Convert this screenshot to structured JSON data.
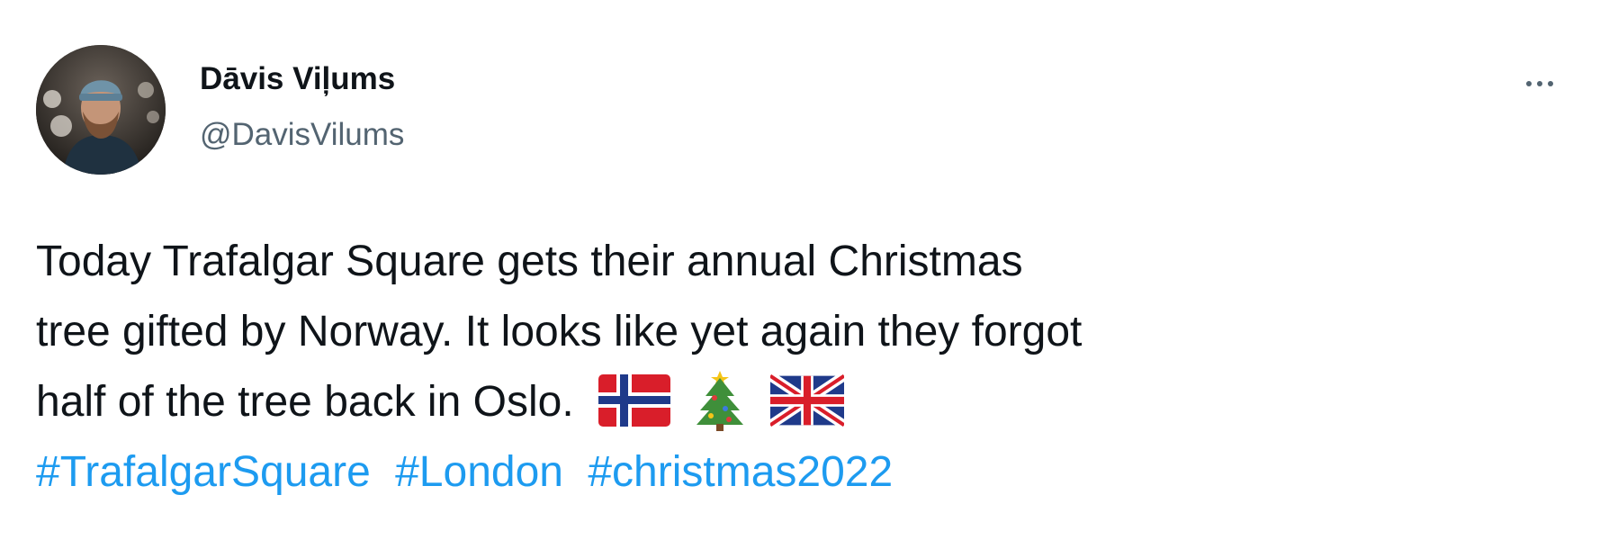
{
  "tweet": {
    "author": {
      "display_name": "Dāvis Viļums",
      "handle": "@DavisVilums"
    },
    "text_lines": [
      "Today Trafalgar Square gets their annual Christmas",
      "tree gifted by Norway. It looks like yet again they forgot",
      "half of the tree back in Oslo."
    ],
    "emojis": [
      "flag-norway-icon",
      "christmas-tree-icon",
      "flag-uk-icon"
    ],
    "hashtags": [
      "#TrafalgarSquare",
      "#London",
      "#christmas2022"
    ],
    "colors": {
      "text": "#0f1419",
      "secondary": "#536471",
      "link": "#1d9bf0"
    }
  }
}
